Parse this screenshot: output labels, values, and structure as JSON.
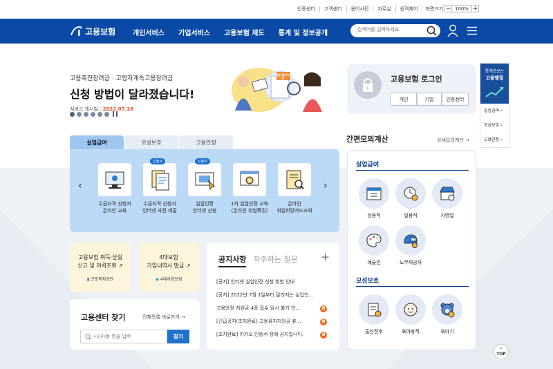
{
  "utility": [
    "인증센터",
    "고객센터",
    "용어사전",
    "자료실",
    "원격제어",
    "화면크기"
  ],
  "zoom": {
    "minus": "−",
    "value": "100%",
    "plus": "+"
  },
  "logo": {
    "text": "고용보험"
  },
  "gnb": [
    "개인서비스",
    "기업서비스",
    "고용보험 제도",
    "통계 및 정보공개"
  ],
  "search": {
    "placeholder": "검색어를 입력하세요."
  },
  "hero": {
    "sub": "고용촉진장려금 · 고령자계속고용장려금",
    "title": "신청 방법이 달라졌습니다!",
    "date_label": "서비스 개시일 : ",
    "date": "2022.07.18",
    "illust_sign": "예상 접수처리"
  },
  "login": {
    "title": "고용보험 로그인",
    "buttons": [
      "개인",
      "기업",
      "인증센터"
    ]
  },
  "side_banner": {
    "top_line1": "통계로보는",
    "top_line2": "고용행정",
    "links": [
      "실업급여",
      "모성보호",
      "고용안정"
    ]
  },
  "tabs": [
    "실업급여",
    "모성보호",
    "고용안정"
  ],
  "services": [
    {
      "badge": "",
      "label1": "수급자격 신청자",
      "label2": "온라인 교육"
    },
    {
      "badge": "신청서",
      "label1": "수급자격 신청서",
      "label2": "인터넷 사전 제출"
    },
    {
      "badge": "신청서",
      "label1": "실업인정",
      "label2": "인터넷 신청"
    },
    {
      "badge": "",
      "label1": "1차 실업인정 교육",
      "label2": "(온라인 취업특강)"
    },
    {
      "badge": "",
      "label1": "온라인",
      "label2": "취업희망카드조회"
    }
  ],
  "cards": {
    "c1_line1": "고용보험 취득·상실",
    "c1_line2": "신고 및 이력조회",
    "c1_org": "근로복지공단",
    "c2_line1": "4대보험",
    "c2_line2": "가입내역서 발급",
    "c2_org": "4대사회보험"
  },
  "center": {
    "title": "고용센터 찾기",
    "link": "전체목록 바로가기",
    "placeholder": "시/구/동 명을 입력",
    "button": "찾기"
  },
  "notice": {
    "tab1": "공지사항",
    "tab2": "자주하는 질문",
    "plus": "+",
    "items": [
      {
        "text": "[공지] 인터넷 실업인정 신청 방법 안내",
        "new": ""
      },
      {
        "text": "[공지] 2022년 7월 1일부터 달라지는 실업인…",
        "new": ""
      },
      {
        "text": "고용안정 지원금 4종 접수 임시 불가 안…",
        "new": "N"
      },
      {
        "text": "[긴급공지(조치완료] 고용유지지원금 휴…",
        "new": "N"
      },
      {
        "text": "[조치완료] 카카오 인증서 장애 공지입니다.",
        "new": "N"
      }
    ]
  },
  "calc": {
    "title": "간편모의계산",
    "link": "상세모의계산",
    "sec1": "실업급여",
    "sec1_items": [
      "상용직",
      "일용직",
      "자영업",
      "예술인",
      "노무제공자"
    ],
    "sec2": "모성보호",
    "sec2_items": [
      "출산전후",
      "육아휴직",
      "육아기"
    ]
  },
  "top": "TOP"
}
